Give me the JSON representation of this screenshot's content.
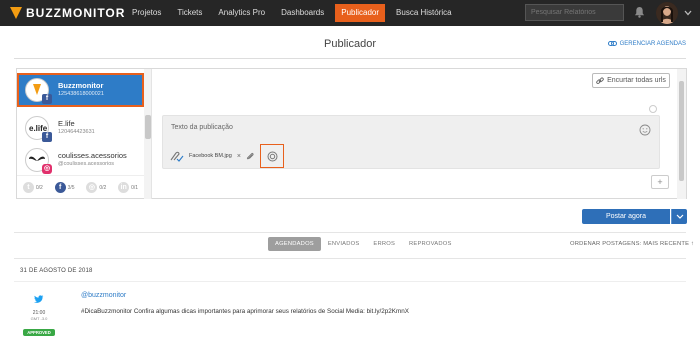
{
  "brand": {
    "name": "BUZZMONITOR"
  },
  "nav": {
    "items": [
      {
        "label": "Projetos"
      },
      {
        "label": "Tickets"
      },
      {
        "label": "Analytics Pro"
      },
      {
        "label": "Dashboards"
      },
      {
        "label": "Publicador"
      },
      {
        "label": "Busca Histórica"
      }
    ],
    "active": "Publicador",
    "search_placeholder": "Pesquisar Relatórios"
  },
  "page": {
    "title": "Publicador",
    "manage_label": "GERENCIAR AGENDAS"
  },
  "accounts": [
    {
      "name": "Buzzmonitor",
      "id": "125438618000021",
      "network": "facebook"
    },
    {
      "name": "E.life",
      "id": "120464423631",
      "network": "facebook"
    },
    {
      "name": "coulisses.acessorios",
      "id": "@coulisses.acessorios",
      "network": "instagram"
    }
  ],
  "counters": [
    {
      "network": "twitter",
      "value": "0/2"
    },
    {
      "network": "facebook",
      "value": "3/5"
    },
    {
      "network": "instagram",
      "value": "0/2"
    },
    {
      "network": "linkedin",
      "value": "0/1"
    }
  ],
  "composer": {
    "shorten_label": "Encurtar todas urls",
    "placeholder": "Texto da publicação",
    "file_name": "Facebook BM.jpg",
    "remove_symbol": "×",
    "add_symbol": "+"
  },
  "actions": {
    "post_now": "Postar agora"
  },
  "filters": {
    "tabs": [
      "AGENDADOS",
      "ENVIADOS",
      "ERROS",
      "REPROVADOS"
    ],
    "active": "AGENDADOS",
    "order_label": "ORDENAR POSTAGENS: MAIS RECENTE"
  },
  "feed": {
    "date": "31 DE AGOSTO DE 2018",
    "posts": [
      {
        "network": "twitter",
        "time": "21:00",
        "tz": "GMT -3.0",
        "status": "APPROVED",
        "handle": "@buzzmonitor",
        "text": "#DicaBuzzmonitor Confira algumas dicas importantes para aprimorar seus relatórios de Social Media: bit.ly/2p2KmnX"
      }
    ]
  },
  "colors": {
    "accent": "#2e7cc7",
    "highlight": "#e8601c",
    "topbar": "#262626",
    "approved": "#39a845"
  }
}
